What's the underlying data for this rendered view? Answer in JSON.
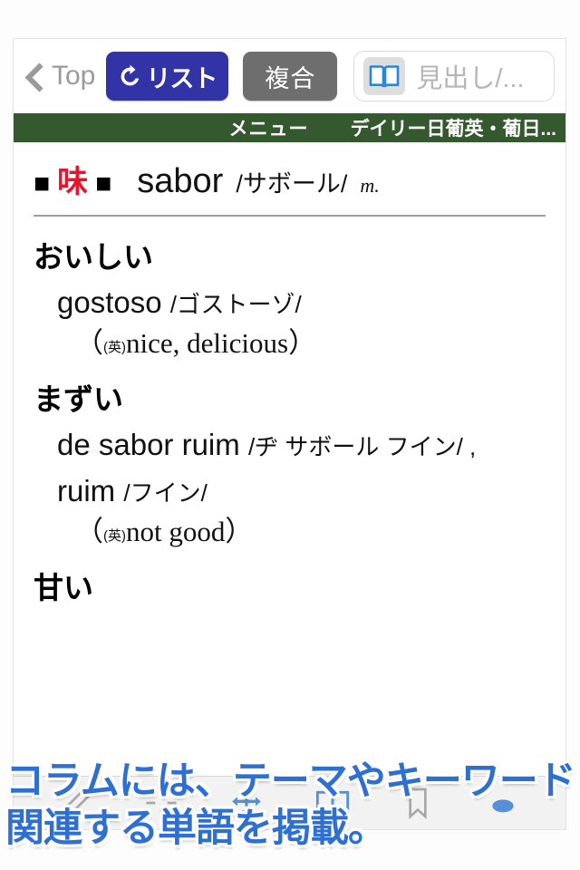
{
  "toolbar": {
    "back_label": "Top",
    "back_icon": "chevron-left-icon",
    "list_button_label": "リスト",
    "list_button_icon": "refresh-arrow-icon",
    "list_button_color": "#3333a8",
    "composite_button_label": "複合",
    "composite_button_color": "#6e6e6e",
    "search_icon": "open-book-icon",
    "search_value": "",
    "search_placeholder": "見出し/..."
  },
  "menu_bar": {
    "background_color": "#34592f",
    "menu_label": "メニュー",
    "dictionary_name": "デイリー日葡英・葡日..."
  },
  "entry": {
    "marker_left": "■",
    "headword_kanji": "味",
    "headword_color": "#e8142d",
    "marker_right": "■",
    "portuguese_word": "sabor",
    "reading": "/サボール/",
    "grammar_tag": "m.",
    "senses": [
      {
        "japanese": "おいしい",
        "portuguese": "gostoso",
        "reading": "/ゴストーゾ/",
        "gloss_mark": "(英)",
        "gloss": "nice, delicious"
      },
      {
        "japanese": "まずい",
        "portuguese": "de sabor ruim",
        "reading": "/ヂ サボール フイン/ ,",
        "portuguese2": "ruim",
        "reading2": "/フイン/",
        "gloss_mark": "(英)",
        "gloss": "not good"
      },
      {
        "japanese": "甘い"
      }
    ]
  },
  "bottom_bar": {
    "icons": [
      "pencil-icon",
      "sparkle-icon",
      "move-arrows-icon",
      "book-icon",
      "bookmark-icon",
      "eye-icon"
    ]
  },
  "promo": {
    "line1": "コラムには、テーマやキーワードごとに",
    "line2": "関連する単語を掲載。",
    "text_color": "#2e6fd4"
  }
}
